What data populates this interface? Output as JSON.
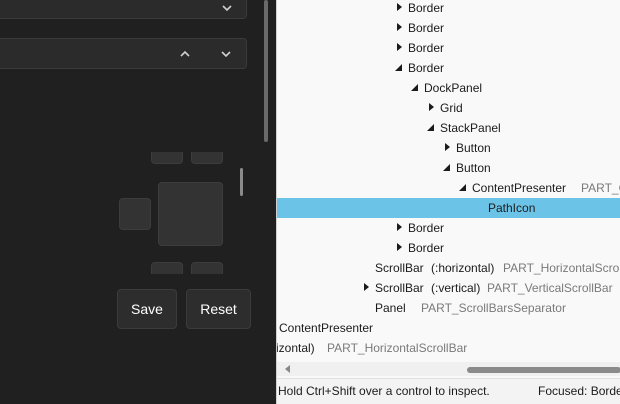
{
  "gallery": {
    "save_label": "Save",
    "reset_label": "Reset"
  },
  "inspector": {
    "tree": [
      {
        "name": "Border",
        "arrow": "right"
      },
      {
        "name": "Border",
        "arrow": "right"
      },
      {
        "name": "Border",
        "arrow": "right"
      },
      {
        "name": "Border",
        "arrow": "down"
      },
      {
        "name": "DockPanel",
        "arrow": "down"
      },
      {
        "name": "Grid",
        "arrow": "right"
      },
      {
        "name": "StackPanel",
        "arrow": "down"
      },
      {
        "name": "Button",
        "arrow": "right"
      },
      {
        "name": "Button",
        "arrow": "down"
      },
      {
        "name": "ContentPresenter",
        "arrow": "down",
        "extra": "PART_C"
      },
      {
        "name": "PathIcon",
        "arrow": "none",
        "selected": true
      },
      {
        "name": "Border",
        "arrow": "right"
      },
      {
        "name": "Border",
        "arrow": "right"
      },
      {
        "name": "ScrollBar",
        "arrow": "none",
        "classes": "(:horizontal)",
        "extra": "PART_HorizontalScrollB"
      },
      {
        "name": "ScrollBar",
        "arrow": "right",
        "classes": "(:vertical)",
        "extra": "PART_VerticalScrollBar"
      },
      {
        "name": "Panel",
        "arrow": "none",
        "extra": "PART_ScrollBarsSeparator"
      },
      {
        "name": "ContentPresenter",
        "arrow": "none"
      },
      {
        "name": "rizontal)",
        "arrow": "none",
        "extra": "PART_HorizontalScrollBar"
      }
    ],
    "status_hint": "Hold Ctrl+Shift over a control to inspect.",
    "status_focused": "Focused: Borde"
  },
  "colors": {
    "selection": "#6cc3e8",
    "panel_bg": "#f9f9f9",
    "app_bg": "#202020"
  }
}
